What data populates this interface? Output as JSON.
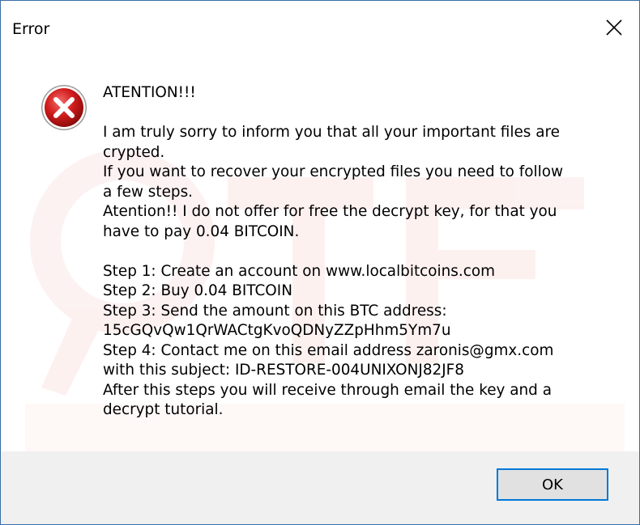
{
  "window": {
    "title": "Error"
  },
  "titlebar": {
    "close_icon": "close-icon"
  },
  "dialog": {
    "icon": "error-icon",
    "lines": [
      "ATENTION!!!",
      "",
      "I am truly sorry to inform you that all your important files are",
      "crypted.",
      "If you want to recover your encrypted files you need to follow",
      "a few steps.",
      "Atention!! I do not offer for free the decrypt key, for that you",
      "have to pay 0.04 BITCOIN.",
      "",
      "Step 1: Create an account on www.localbitcoins.com",
      "Step 2: Buy 0.04 BITCOIN",
      "Step 3: Send the amount on this BTC address:",
      "15cGQvQw1QrWACtgKvoQDNyZZpHhm5Ym7u",
      "Step 4: Contact me on this email address zaronis@gmx.com",
      "with this subject: ID-RESTORE-004UNIXONJ82JF8",
      "After this steps you will receive through email the key and a",
      "decrypt tutorial."
    ]
  },
  "footer": {
    "ok_label": "OK"
  },
  "colors": {
    "accent": "#0078d7",
    "footer_bg": "#f0f0f0",
    "button_bg": "#e1e1e1",
    "error_red": "#c4161c"
  }
}
